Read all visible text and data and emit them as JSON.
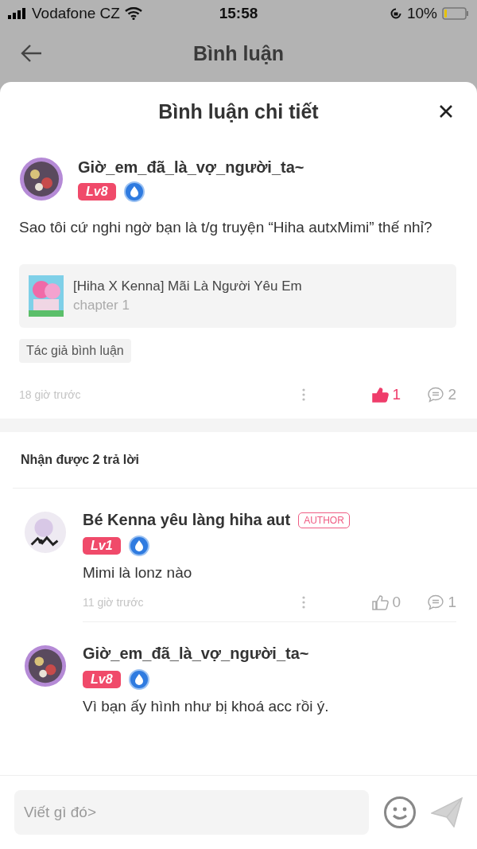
{
  "status_bar": {
    "carrier": "Vodafone CZ",
    "time": "15:58",
    "battery": "10%"
  },
  "header": {
    "title": "Bình luận"
  },
  "sheet": {
    "title": "Bình luận chi tiết"
  },
  "comment": {
    "user": "Giờ_em_đã_là_vợ_người_ta~",
    "level": "Lv8",
    "text": "Sao tôi cứ nghi ngờ bạn là t/g truyện “Hiha autxMimi” thế nhỉ?",
    "story": {
      "title": "[Hiha X Kenna] Mãi Là Người Yêu Em",
      "chapter": "chapter 1"
    },
    "tag": "Tác giả bình luận",
    "time": "18 giờ trước",
    "likes": "1",
    "liked": true,
    "replies": "2"
  },
  "replies_heading": "Nhận được 2 trả lời",
  "replies": [
    {
      "user": "Bé Kenna yêu làng hiha aut",
      "author": true,
      "author_label": "AUTHOR",
      "level": "Lv1",
      "text": "Mimi là lonz nào",
      "time": "11 giờ trước",
      "likes": "0",
      "liked": false,
      "replies": "1"
    },
    {
      "user": "Giờ_em_đã_là_vợ_người_ta~",
      "author": false,
      "level": "Lv8",
      "text": "Vì bạn ấy hình như bị khoá acc rồi ý."
    }
  ],
  "composer": {
    "placeholder": "Viết gì đó>"
  }
}
